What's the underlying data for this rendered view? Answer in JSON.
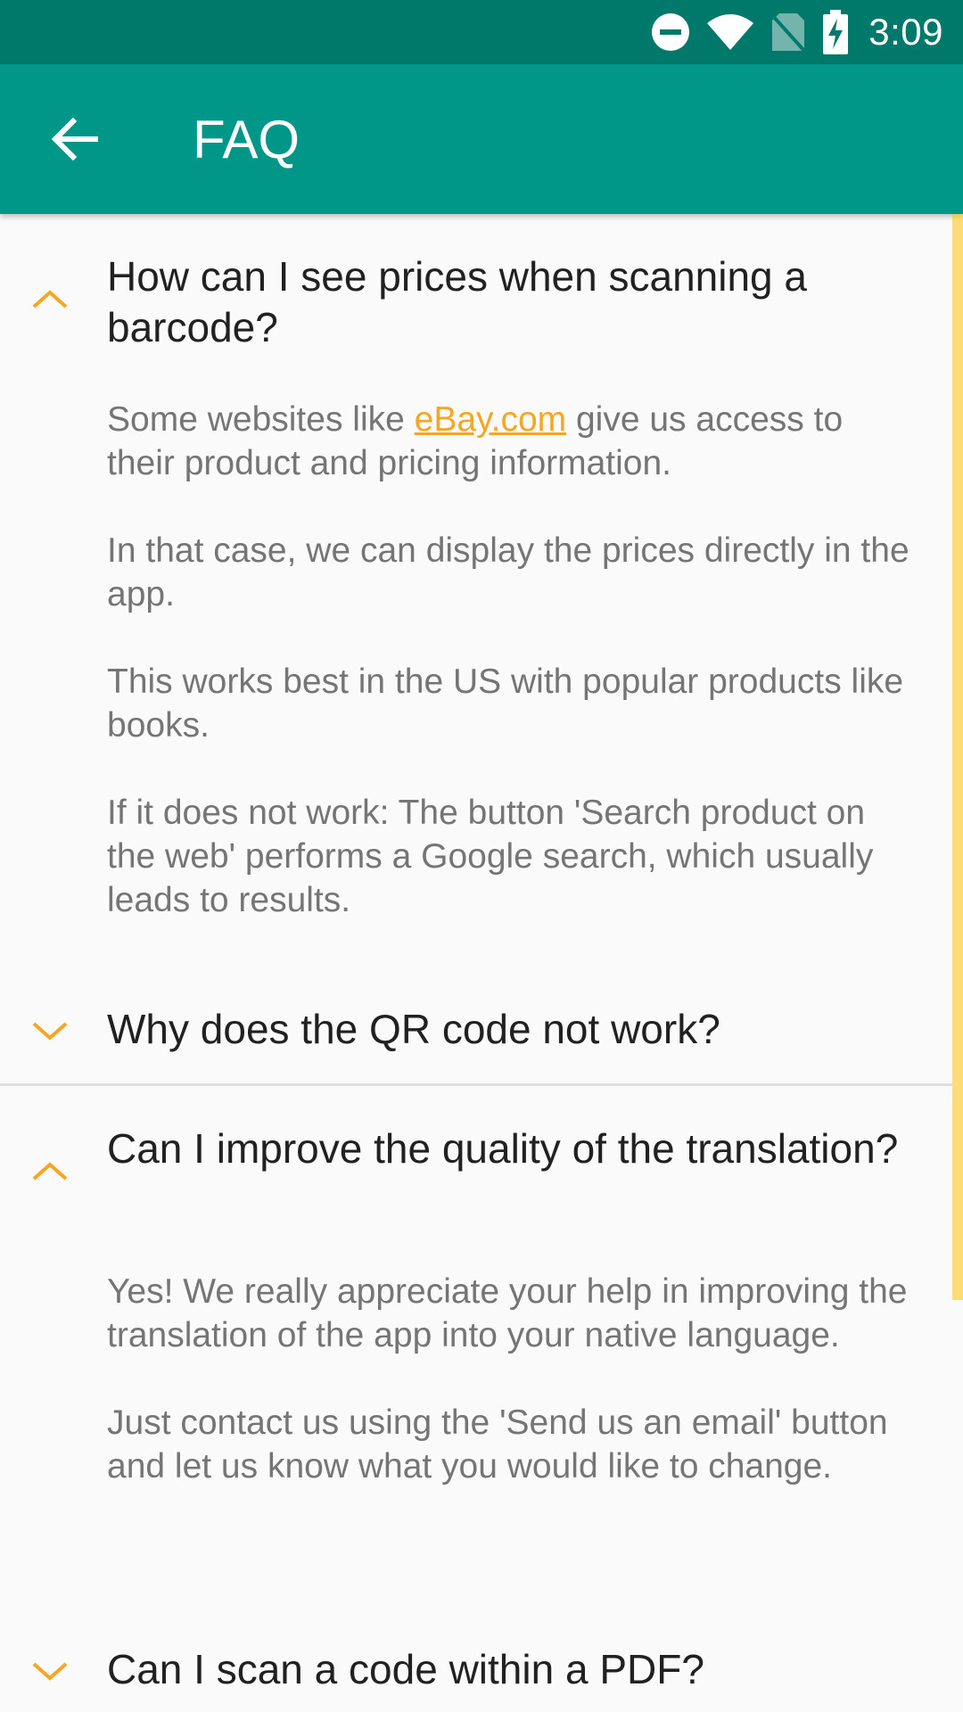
{
  "status": {
    "time": "3:09"
  },
  "appbar": {
    "title": "FAQ",
    "back_icon": "arrow-back-icon"
  },
  "colors": {
    "primary": "#009688",
    "primary_dark": "#00796b",
    "accent": "#f5a623"
  },
  "faqs": [
    {
      "question": "How can I see prices when scanning a barcode?",
      "expanded": true,
      "answer": {
        "p1_before": "Some websites like ",
        "p1_link": "eBay.com",
        "p1_after": " give us access to their product and pricing information.",
        "p2": "In that case, we can display the prices directly in the app.",
        "p3": "This works best in the US with popular products like books.",
        "p4": "If it does not work: The button 'Search product on the web' performs a Google search, which usually leads to results."
      }
    },
    {
      "question": "Why does the QR code not work?",
      "expanded": false
    },
    {
      "question": "Can I improve the quality of the translation?",
      "expanded": true,
      "answer": {
        "p1": "Yes! We really appreciate your help in improving the translation of the app into your native language.",
        "p2": "Just contact us using the 'Send us an email' button and let us know what you would like to change."
      }
    },
    {
      "question": "Can I scan a code within a PDF?",
      "expanded": false
    }
  ]
}
